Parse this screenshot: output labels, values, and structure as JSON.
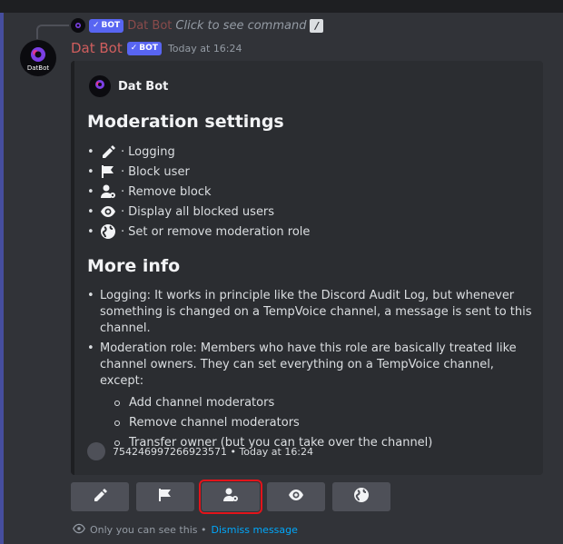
{
  "reply": {
    "bot_tag": "BOT",
    "username": "Dat Bot",
    "command_text": "Click to see command"
  },
  "message": {
    "avatar_text": "DatBot",
    "username": "Dat Bot",
    "bot_tag": "BOT",
    "timestamp": "Today at 16:24"
  },
  "embed": {
    "author": "Dat Bot",
    "heading1": "Moderation settings",
    "settings": [
      {
        "icon": "pencil-icon",
        "label": "Logging"
      },
      {
        "icon": "flag-icon",
        "label": "Block user"
      },
      {
        "icon": "user-cog-icon",
        "label": "Remove block"
      },
      {
        "icon": "eye-icon",
        "label": "Display all blocked users"
      },
      {
        "icon": "globe-icon",
        "label": "Set or remove moderation role"
      }
    ],
    "heading2": "More info",
    "info": [
      "Logging: It works in principle like the Discord Audit Log, but whenever something is changed on a TempVoice channel, a message is sent to this channel.",
      "Moderation role: Members who have this role are basically treated like channel owners. They can set everything on a TempVoice channel, except:"
    ],
    "sub_items": [
      "Add channel moderators",
      "Remove channel moderators",
      "Transfer owner (but you can take over the channel)"
    ],
    "footer": "754246997266923571 • Today at 16:24"
  },
  "buttons": [
    "pencil-icon",
    "flag-icon",
    "user-cog-icon",
    "eye-icon",
    "globe-icon"
  ],
  "ephemeral": {
    "text": "Only you can see this •",
    "dismiss": "Dismiss message"
  },
  "colors": {
    "accent": "#5865f2",
    "username": "#d05e5e",
    "link": "#00a8fc",
    "highlight": "#e3141b"
  }
}
